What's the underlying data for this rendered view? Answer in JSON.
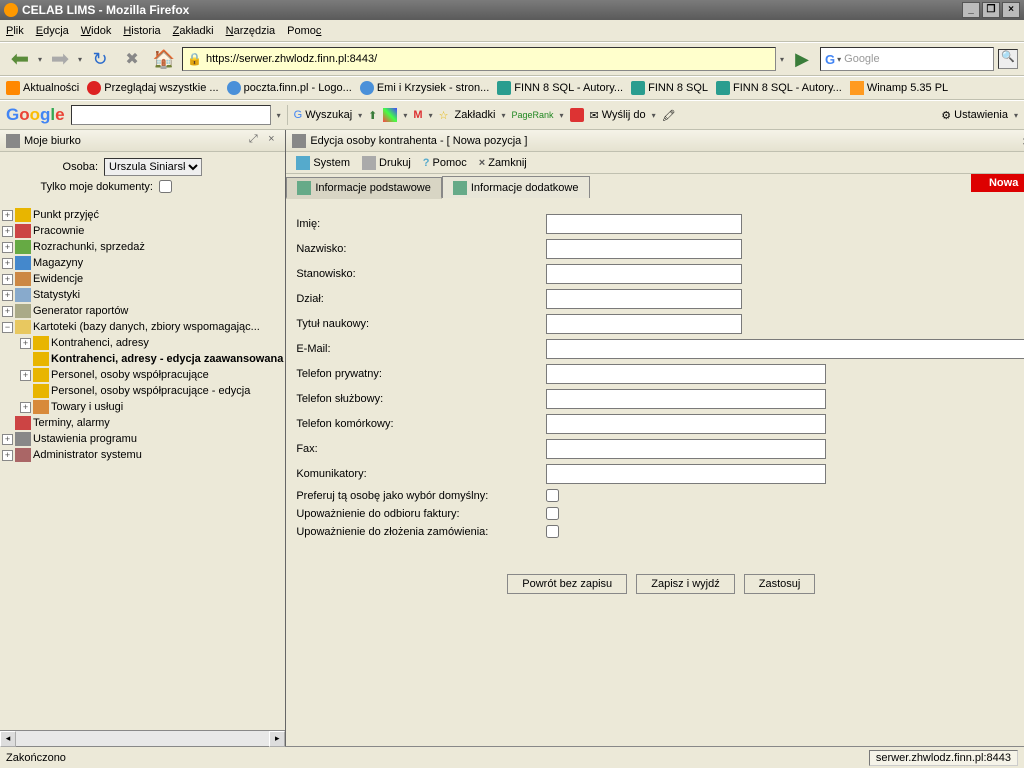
{
  "window": {
    "title": "CELAB LIMS - Mozilla Firefox"
  },
  "menu": {
    "file": "Plik",
    "edit": "Edycja",
    "view": "Widok",
    "history": "Historia",
    "bookmarks": "Zakładki",
    "tools": "Narzędzia",
    "help": "Pomoc"
  },
  "url": "https://serwer.zhwlodz.finn.pl:8443/",
  "search": {
    "placeholder": "Google"
  },
  "bookmarks": {
    "b0": "Aktualności",
    "b1": "Przeglądaj wszystkie ...",
    "b2": "poczta.finn.pl - Logo...",
    "b3": "Emi i Krzysiek - stron...",
    "b4": "FINN 8 SQL - Autory...",
    "b5": "FINN 8 SQL",
    "b6": "FINN 8 SQL - Autory...",
    "b7": "Winamp 5.35 PL"
  },
  "googlebar": {
    "search": "Wyszukaj",
    "bookmarks": "Zakładki",
    "pagerank": "PageRank",
    "send": "Wyślij do",
    "settings": "Ustawienia"
  },
  "left": {
    "title": "Moje biurko",
    "osoba_label": "Osoba:",
    "osoba_value": "Urszula Siniarska",
    "docs_label": "Tylko moje dokumenty:",
    "tree": {
      "t0": "Punkt przyjęć",
      "t1": "Pracownie",
      "t2": "Rozrachunki, sprzedaż",
      "t3": "Magazyny",
      "t4": "Ewidencje",
      "t5": "Statystyki",
      "t6": "Generator raportów",
      "t7": "Kartoteki (bazy danych, zbiory wspomagając...",
      "t7a": "Kontrahenci, adresy",
      "t7b": "Kontrahenci, adresy - edycja zaawansowana",
      "t7c": "Personel, osoby współpracujące",
      "t7d": "Personel, osoby współpracujące - edycja",
      "t7e": "Towary i usługi",
      "t8": "Terminy, alarmy",
      "t9": "Ustawienia programu",
      "t10": "Administrator systemu"
    }
  },
  "right": {
    "title": "Edycja osoby kontrahenta - [ Nowa pozycja ]",
    "toolbar": {
      "system": "System",
      "print": "Drukuj",
      "help": "Pomoc",
      "close": "Zamknij"
    },
    "tabs": {
      "basic": "Informacje podstawowe",
      "extra": "Informacje dodatkowe",
      "nowa": "Nowa"
    },
    "form": {
      "imie": "Imię:",
      "nazwisko": "Nazwisko:",
      "stanowisko": "Stanowisko:",
      "dzial": "Dział:",
      "tytul": "Tytuł naukowy:",
      "email": "E-Mail:",
      "tel_p": "Telefon prywatny:",
      "tel_s": "Telefon służbowy:",
      "tel_k": "Telefon komórkowy:",
      "fax": "Fax:",
      "komun": "Komunikatory:",
      "pref": "Preferuj tą osobę jako wybór domyślny:",
      "upow_f": "Upoważnienie do odbioru faktury:",
      "upow_z": "Upoważnienie do złożenia zamówienia:"
    },
    "buttons": {
      "back": "Powrót bez zapisu",
      "save": "Zapisz i wyjdź",
      "apply": "Zastosuj"
    }
  },
  "status": {
    "done": "Zakończono",
    "server": "serwer.zhwlodz.finn.pl:8443"
  }
}
